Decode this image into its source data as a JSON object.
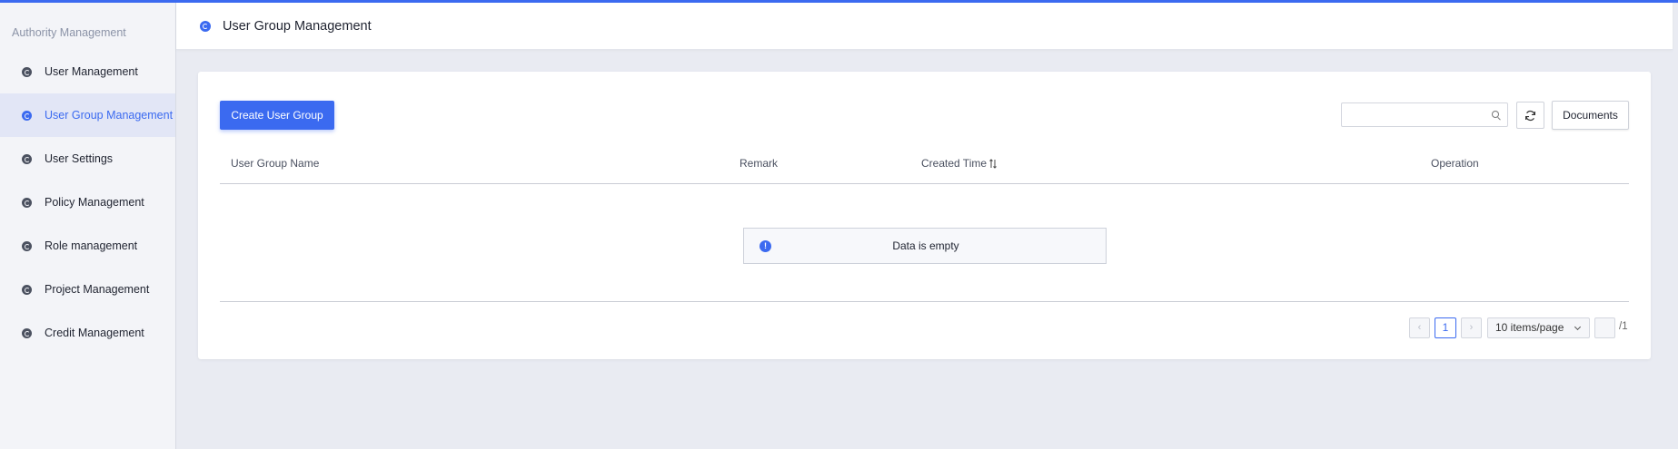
{
  "sidebar": {
    "heading": "Authority Management",
    "items": [
      {
        "label": "User Management",
        "active": false
      },
      {
        "label": "User Group Management",
        "active": true
      },
      {
        "label": "User Settings",
        "active": false
      },
      {
        "label": "Policy Management",
        "active": false
      },
      {
        "label": "Role management",
        "active": false
      },
      {
        "label": "Project Management",
        "active": false
      },
      {
        "label": "Credit Management",
        "active": false
      }
    ]
  },
  "header": {
    "title": "User Group Management"
  },
  "toolbar": {
    "create_label": "Create User Group",
    "search_placeholder": "",
    "documents_label": "Documents"
  },
  "table": {
    "columns": [
      "User Group Name",
      "Remark",
      "Created Time",
      "Operation"
    ],
    "rows": [],
    "empty_text": "Data is empty"
  },
  "pagination": {
    "prev": "‹",
    "next": "›",
    "current_page": "1",
    "page_size": "10 items/page",
    "jump_value": "",
    "total_pages": "/1"
  },
  "colors": {
    "accent": "#3b6af0",
    "background": "#e9ebf2",
    "sidebar": "#f3f4f8"
  }
}
